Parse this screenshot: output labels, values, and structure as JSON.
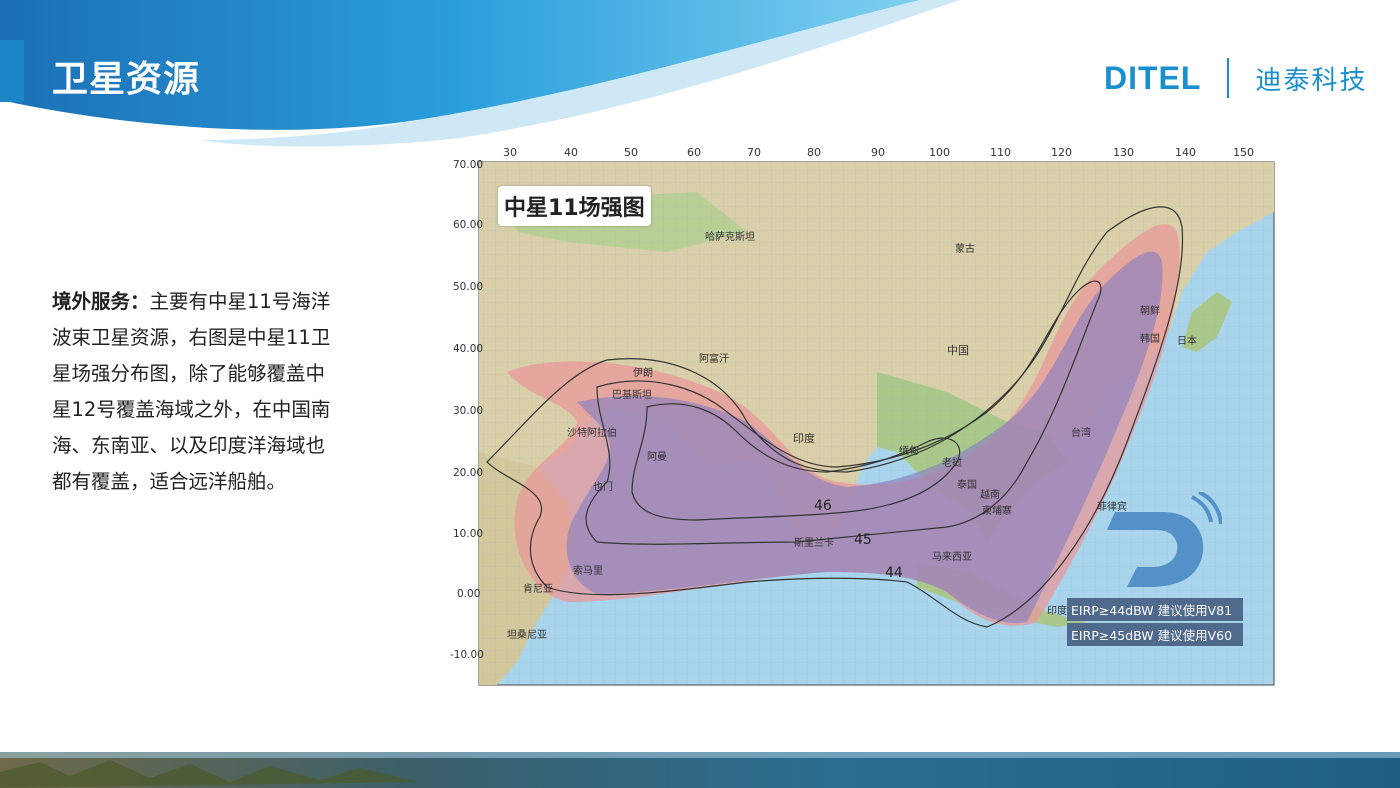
{
  "header": {
    "title": "卫星资源",
    "logo_en": "DITEL",
    "logo_cn": "迪泰科技"
  },
  "description": {
    "lead": "境外服务：",
    "body": "主要有中星11号海洋波束卫星资源，右图是中星11卫星场强分布图，除了能够覆盖中星12号覆盖海域之外，在中国南海、东南亚、以及印度洋海域也都有覆盖，适合远洋船舶。"
  },
  "map": {
    "title": "中星11场强图",
    "lon_ticks": [
      "30",
      "40",
      "50",
      "60",
      "70",
      "80",
      "90",
      "100",
      "110",
      "120",
      "130",
      "140",
      "150"
    ],
    "lat_ticks": [
      "70.00",
      "60.00",
      "50.00",
      "40.00",
      "30.00",
      "20.00",
      "10.00",
      "0.00",
      "-10.00"
    ],
    "contour_labels": [
      "46",
      "45",
      "44"
    ],
    "legend": [
      "EIRP≥44dBW 建议使用V81",
      "EIRP≥45dBW 建议使用V60"
    ],
    "place_labels": [
      "中国",
      "蒙古",
      "印度",
      "哈萨克斯坦",
      "阿富汗",
      "伊朗",
      "沙特阿拉伯",
      "泰国",
      "越南",
      "菲律宾",
      "马来西亚",
      "印度尼西亚",
      "日本",
      "韩国",
      "朝鲜",
      "台湾",
      "巴基斯坦",
      "阿曼",
      "也门",
      "索马里",
      "肯尼亚",
      "坦桑尼亚",
      "斯里兰卡",
      "老挝",
      "缅甸",
      "柬埔寨"
    ],
    "colors": {
      "sea": "#a8d4ec",
      "land": "#d9cfa8",
      "land_green": "#a9c88a",
      "beam_outer": "#e89a9a",
      "beam_inner": "#8a80c0",
      "contour": "#333333"
    }
  }
}
